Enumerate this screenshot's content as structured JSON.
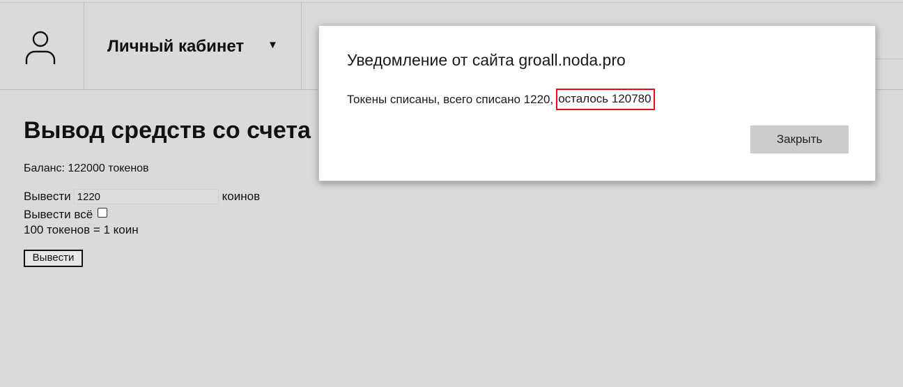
{
  "header": {
    "avatar_icon": "user-icon",
    "menu_label": "Личный кабинет",
    "menu_caret": "▼"
  },
  "main": {
    "title": "Вывод средств со счета",
    "balance": "Баланс: 122000 токенов",
    "withdraw_label": "Вывести",
    "withdraw_value": "1220",
    "withdraw_unit": "коинов",
    "withdraw_all_label": "Вывести всё",
    "withdraw_all_checked": false,
    "rate": "100 токенов = 1 коин",
    "submit_label": "Вывести"
  },
  "dialog": {
    "title": "Уведомление от сайта groall.noda.pro",
    "message_prefix": "Токены списаны, всего списано 1220,",
    "message_highlight": "осталось 120780",
    "highlight_color": "#e0111a",
    "close_label": "Закрыть"
  }
}
